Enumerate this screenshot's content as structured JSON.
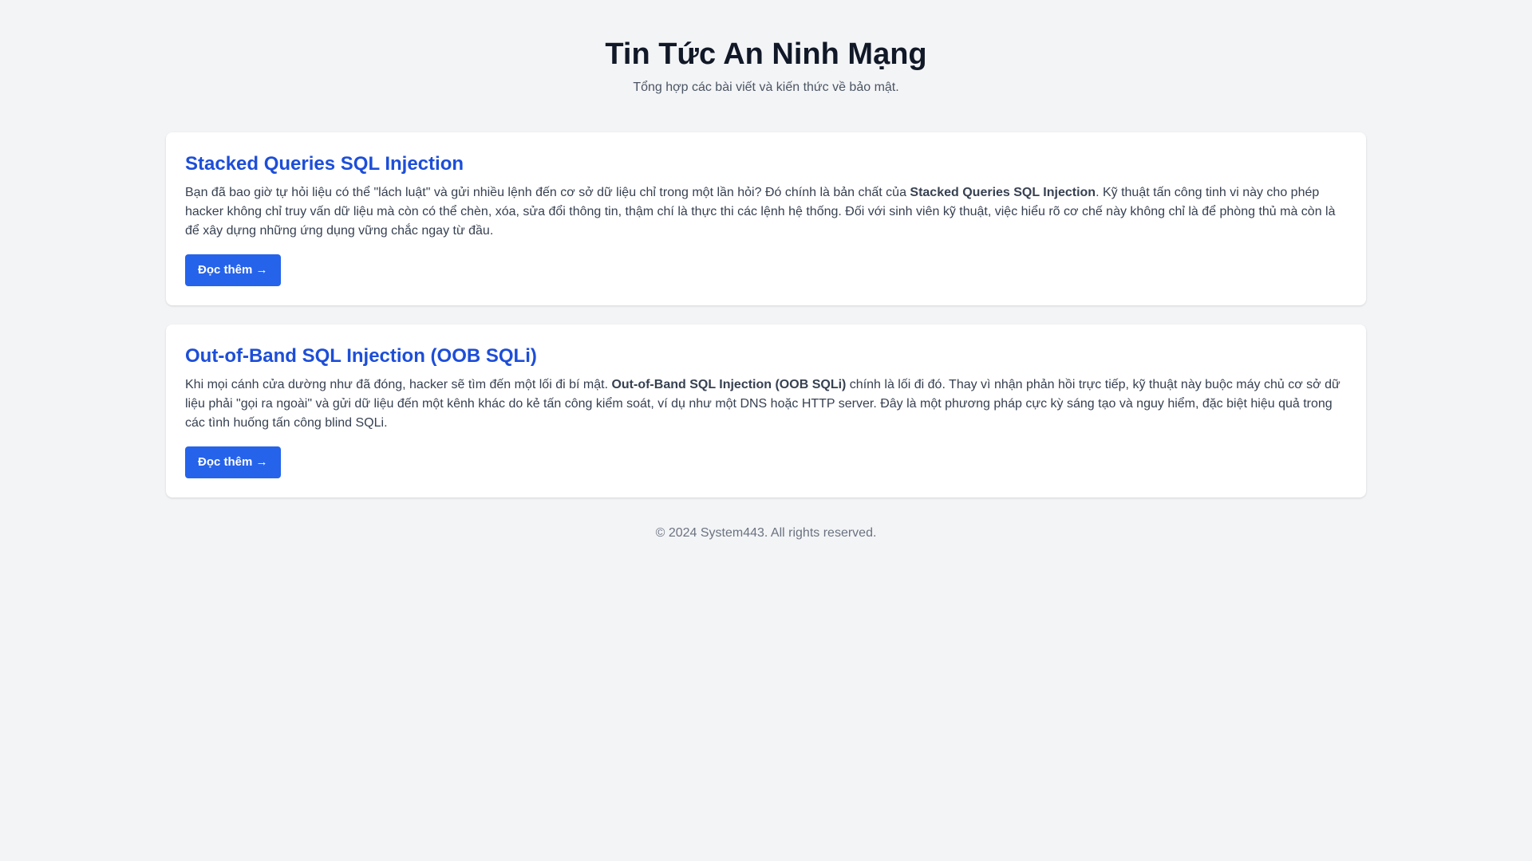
{
  "header": {
    "title": "Tin Tức An Ninh Mạng",
    "subtitle": "Tổng hợp các bài viết và kiến thức về bảo mật."
  },
  "articles": [
    {
      "title": "Stacked Queries SQL Injection",
      "text_before": "Bạn đã bao giờ tự hỏi liệu có thể \"lách luật\" và gửi nhiều lệnh đến cơ sở dữ liệu chỉ trong một lần hỏi? Đó chính là bản chất của ",
      "text_strong": "Stacked Queries SQL Injection",
      "text_after": ". Kỹ thuật tấn công tinh vi này cho phép hacker không chỉ truy vấn dữ liệu mà còn có thể chèn, xóa, sửa đổi thông tin, thậm chí là thực thi các lệnh hệ thống. Đối với sinh viên kỹ thuật, việc hiểu rõ cơ chế này không chỉ là để phòng thủ mà còn là để xây dựng những ứng dụng vững chắc ngay từ đầu.",
      "button_label": "Đọc thêm →"
    },
    {
      "title": "Out-of-Band SQL Injection (OOB SQLi)",
      "text_before": "Khi mọi cánh cửa dường như đã đóng, hacker sẽ tìm đến một lối đi bí mật. ",
      "text_strong": "Out-of-Band SQL Injection (OOB SQLi)",
      "text_after": " chính là lối đi đó. Thay vì nhận phản hồi trực tiếp, kỹ thuật này buộc máy chủ cơ sở dữ liệu phải \"gọi ra ngoài\" và gửi dữ liệu đến một kênh khác do kẻ tấn công kiểm soát, ví dụ như một DNS hoặc HTTP server. Đây là một phương pháp cực kỳ sáng tạo và nguy hiểm, đặc biệt hiệu quả trong các tình huống tấn công blind SQLi.",
      "button_label": "Đọc thêm →"
    }
  ],
  "footer": {
    "copyright": "© 2024 System443. All rights reserved."
  }
}
